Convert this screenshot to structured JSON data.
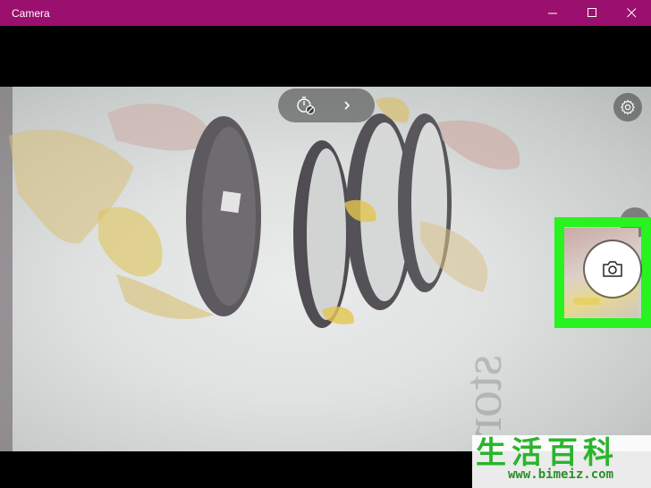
{
  "window": {
    "title": "Camera",
    "controls": {
      "minimize": "minimize",
      "maximize": "maximize",
      "close": "close"
    }
  },
  "toolbar": {
    "timer_icon": "timer-off-icon",
    "expand_icon": "chevron-right-icon",
    "settings_icon": "gear-icon"
  },
  "capture": {
    "shutter_icon": "camera-icon",
    "thumbnail": "last-photo-thumbnail"
  },
  "watermark": {
    "chars": "生活百科",
    "url": "www.bimeiz.com"
  },
  "colors": {
    "titlebar": "#9b0f6e",
    "highlight": "#28f21f",
    "watermark_green": "#2ab52a"
  }
}
